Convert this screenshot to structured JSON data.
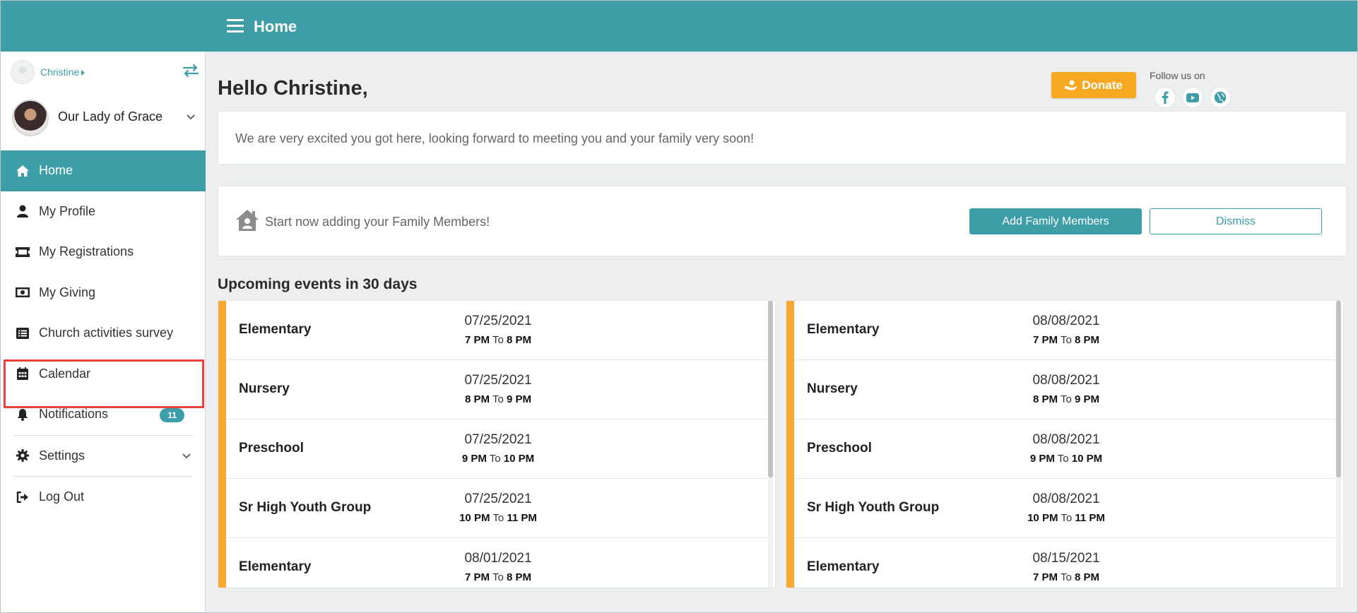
{
  "header": {
    "title": "Home"
  },
  "sidebar": {
    "user_name": "Christine",
    "parish_name": "Our Lady of Grace",
    "items": [
      {
        "label": "Home",
        "icon": "home-icon"
      },
      {
        "label": "My Profile",
        "icon": "user-icon"
      },
      {
        "label": "My Registrations",
        "icon": "ticket-icon"
      },
      {
        "label": "My Giving",
        "icon": "money-icon"
      },
      {
        "label": "Church activities survey",
        "icon": "list-icon"
      },
      {
        "label": "Calendar",
        "icon": "calendar-icon"
      },
      {
        "label": "Notifications",
        "icon": "bell-icon",
        "badge": "11"
      },
      {
        "label": "Settings",
        "icon": "gear-icon"
      },
      {
        "label": "Log Out",
        "icon": "logout-icon"
      }
    ]
  },
  "main": {
    "greeting": "Hello Christine,",
    "donate_label": "Donate",
    "follow_label": "Follow us on",
    "welcome_message": "We are very excited you got here, looking forward to meeting you and your family very soon!",
    "family_prompt": "Start now adding your Family Members!",
    "add_family_label": "Add Family Members",
    "dismiss_label": "Dismiss",
    "events_title": "Upcoming events in 30 days",
    "time_sep": "To",
    "events_left": [
      {
        "name": "Elementary",
        "date": "07/25/2021",
        "start": "7 PM",
        "end": "8 PM"
      },
      {
        "name": "Nursery",
        "date": "07/25/2021",
        "start": "8 PM",
        "end": "9 PM"
      },
      {
        "name": "Preschool",
        "date": "07/25/2021",
        "start": "9 PM",
        "end": "10 PM"
      },
      {
        "name": "Sr High Youth Group",
        "date": "07/25/2021",
        "start": "10 PM",
        "end": "11 PM"
      },
      {
        "name": "Elementary",
        "date": "08/01/2021",
        "start": "7 PM",
        "end": "8 PM"
      }
    ],
    "events_right": [
      {
        "name": "Elementary",
        "date": "08/08/2021",
        "start": "7 PM",
        "end": "8 PM"
      },
      {
        "name": "Nursery",
        "date": "08/08/2021",
        "start": "8 PM",
        "end": "9 PM"
      },
      {
        "name": "Preschool",
        "date": "08/08/2021",
        "start": "9 PM",
        "end": "10 PM"
      },
      {
        "name": "Sr High Youth Group",
        "date": "08/08/2021",
        "start": "10 PM",
        "end": "11 PM"
      },
      {
        "name": "Elementary",
        "date": "08/15/2021",
        "start": "7 PM",
        "end": "8 PM"
      }
    ]
  },
  "colors": {
    "brand": "#3e9ea8",
    "accent": "#f6a821",
    "highlight": "#e8413e"
  }
}
